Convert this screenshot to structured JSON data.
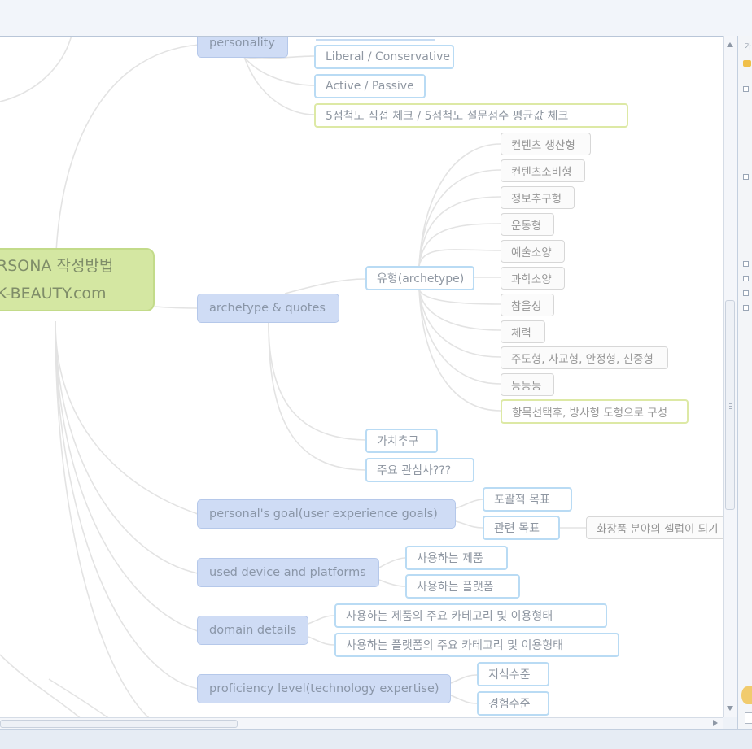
{
  "root": {
    "line1": "RSONA 작성방법",
    "line2": "K-BEAUTY.com"
  },
  "branches": {
    "personality": "personality",
    "archetype": "archetype & quotes",
    "goal": "personal's goal(user experience goals)",
    "device": "used device and platforms",
    "domain": "domain details",
    "proficiency": "proficiency level(technology expertise)"
  },
  "personality_children": {
    "liberal": "Liberal / Conservative",
    "active": "Active / Passive",
    "scale": "5점척도 직접 체크 / 5점척도 설문점수 평균값 체크"
  },
  "archetype_children": {
    "type": "유형(archetype)",
    "value": "가치추구",
    "interest": "주요 관심사???"
  },
  "type_leaves": [
    "컨텐츠 생산형",
    "컨텐츠소비형",
    "정보추구형",
    "운동형",
    "예술소양",
    "과학소양",
    "참을성",
    "체력",
    "주도형, 사교형, 안정형, 신중형",
    "등등등",
    "항목선택후, 방사형 도형으로 구성"
  ],
  "goal_children": {
    "overall": "포괄적 목표",
    "related": "관련 목표",
    "related_leaf": "화장품 분야의 셀럽이 되기"
  },
  "device_children": {
    "product": "사용하는 제품",
    "platform": "사용하는 플랫폼"
  },
  "domain_children": {
    "product_cat": "사용하는 제품의 주요 카테고리 및 이용형태",
    "platform_cat": "사용하는 플랫폼의 주요 카테고리 및 이용형태"
  },
  "proficiency_children": {
    "knowledge": "지식수준",
    "experience": "경험수준"
  },
  "side_panel": {
    "title": "가"
  },
  "colors": {
    "root_fill": "#d4e7a2",
    "branch_fill": "#cfdcf5",
    "sub_border": "#b9dbf4",
    "highlight_border": "#dde9a5",
    "edge": "#e3e3e3"
  }
}
